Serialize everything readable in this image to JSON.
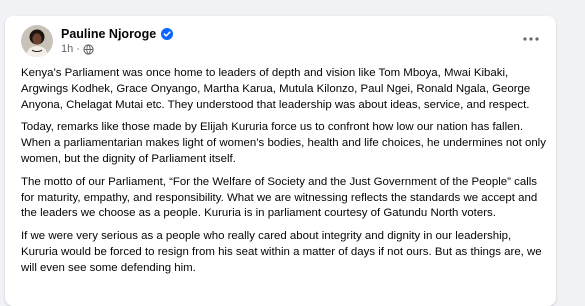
{
  "post": {
    "author": "Pauline Njoroge",
    "time": "1h",
    "separator": "·",
    "icons": {
      "verified": "verified-badge-icon",
      "audience": "globe-icon",
      "menu": "more-horizontal-icon"
    },
    "paragraphs": [
      "Kenya’s Parliament was once home to leaders of depth and vision like Tom Mboya, Mwai Kibaki, Argwings Kodhek, Grace Onyango, Martha Karua, Mutula Kilonzo, Paul Ngei, Ronald Ngala, George Anyona, Chelagat Mutai etc. They understood that leadership was about ideas, service, and respect.",
      "Today, remarks like those made by Elijah Kururia force us to confront how low our nation has fallen. When a parliamentarian makes light of women’s bodies, health and life choices, he undermines not only women, but the dignity of Parliament itself.",
      "The motto of our Parliament, “For the Welfare of Society and the Just Government of the People” calls for maturity, empathy, and responsibility. What we are witnessing reflects the standards we accept and the leaders we choose as a people. Kururia is in parliament courtesy of Gatundu North voters.",
      "If we were very serious as a people who really cared about integrity and dignity in our leadership, Kururia would be forced to resign from his seat within a matter of days if not ours. But as things are, we will even see some defending him."
    ]
  },
  "colors": {
    "page_bg": "#f0f2f5",
    "card_bg": "#ffffff",
    "text": "#050505",
    "secondary_text": "#65676b",
    "verified": "#0866ff"
  }
}
